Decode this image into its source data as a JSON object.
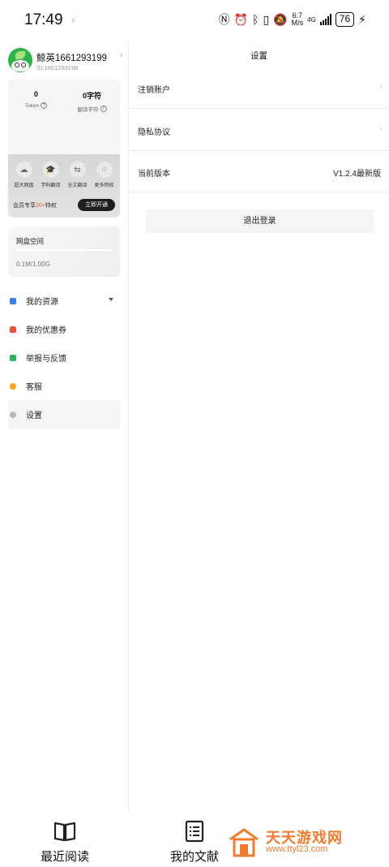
{
  "status_bar": {
    "time": "17:49",
    "speed_value": "6.7",
    "speed_unit": "M/s",
    "network": "4G",
    "battery": "76"
  },
  "sidebar": {
    "username": "鲸英1661293199",
    "user_id": "ID:1661293199",
    "stats": [
      {
        "value": "0",
        "label": "Token"
      },
      {
        "value": "0字符",
        "label": "翻译字符"
      }
    ],
    "vip_features": [
      {
        "label": "超大网盘",
        "icon": "cloud-icon"
      },
      {
        "label": "学科翻译",
        "icon": "graduation-cap-icon"
      },
      {
        "label": "全文翻译",
        "icon": "translate-icon"
      },
      {
        "label": "更多特权",
        "icon": "grid-icon"
      }
    ],
    "vip_text_prefix": "会员专享",
    "vip_text_highlight": "20+",
    "vip_text_suffix": "特权",
    "vip_button": "立即开通",
    "disk_title": "网盘空间",
    "disk_usage": "0.1M/1.00G",
    "disk_fraction": 0.0001,
    "menu": [
      {
        "label": "我的资源",
        "icon": "resource-icon",
        "color": "#3d7be8"
      },
      {
        "label": "我的优惠券",
        "icon": "coupon-icon",
        "color": "#e8503d"
      },
      {
        "label": "举报与反馈",
        "icon": "feedback-icon",
        "color": "#2bb55e"
      },
      {
        "label": "客服",
        "icon": "service-icon",
        "color": "#f5a623"
      },
      {
        "label": "设置",
        "icon": "settings-icon",
        "color": "#b8b8b8"
      }
    ]
  },
  "main": {
    "title": "设置",
    "rows": [
      {
        "label": "注销账户"
      },
      {
        "label": "隐私协议"
      },
      {
        "label": "当前版本",
        "value": "V1.2.4最新版"
      }
    ],
    "logout": "退出登录"
  },
  "bottom_nav": [
    {
      "label": "最近阅读",
      "icon": "book-icon"
    },
    {
      "label": "我的文献",
      "icon": "list-icon"
    }
  ],
  "watermark": {
    "name": "天天游戏网",
    "url": "www.ttyl23.com"
  },
  "colors": {
    "accent_orange": "#f25a2a",
    "vip_button": "#1d1d1d",
    "watermark": "#f07b2e"
  }
}
